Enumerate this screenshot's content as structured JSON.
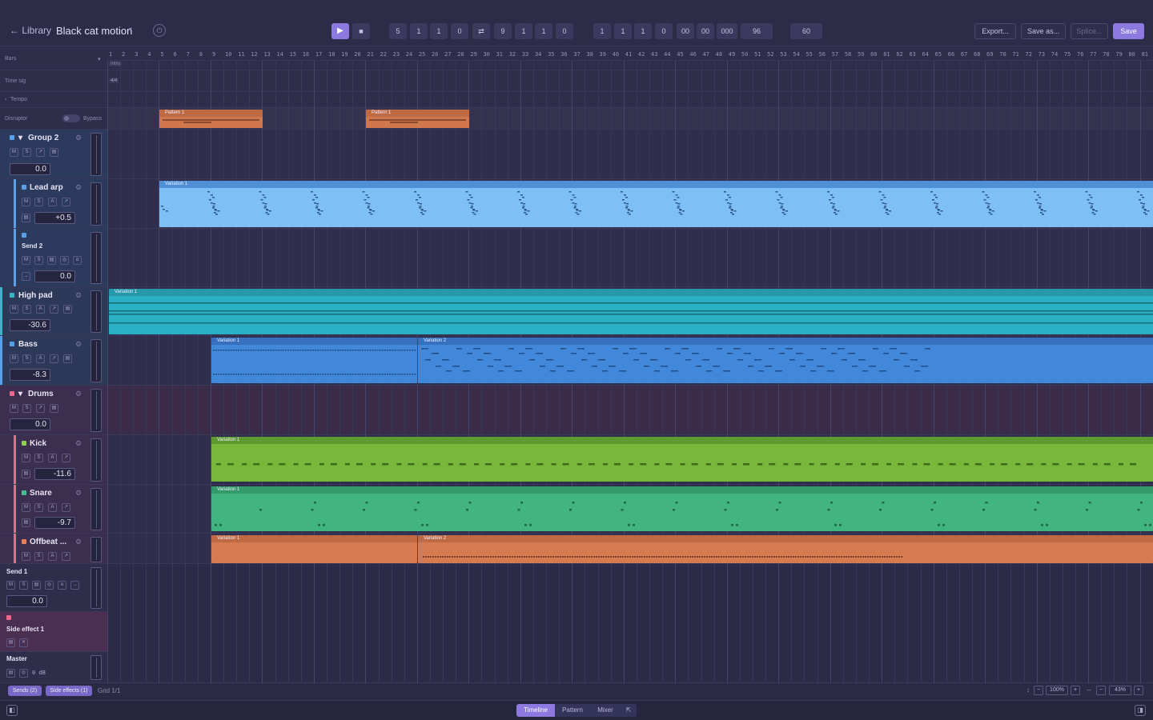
{
  "header": {
    "back_label": "← Library",
    "song_title": "Black cat motion",
    "transport": {
      "play_icon": "▶",
      "stop_icon": "■",
      "loop_start": [
        "5",
        "1",
        "1",
        "0"
      ],
      "loop_icon": "⇄",
      "loop_end": [
        "9",
        "1",
        "1",
        "0"
      ],
      "position": [
        "1",
        "1",
        "1",
        "0",
        "00",
        "00",
        "000"
      ],
      "ppq": "96",
      "bpm": "60"
    },
    "export_label": "Export...",
    "save_as_label": "Save as...",
    "splice_label": "Splice...",
    "save_label": "Save"
  },
  "arrange_header": {
    "bars_label": "Bars",
    "timesig_label": "Time sig",
    "timesig_value": "4/4",
    "tempo_label": "Tempo",
    "marker": "Intro",
    "disruptor_label": "Disruptor",
    "bypass_label": "Bypass",
    "bar_numbers": [
      "1",
      "2",
      "3",
      "4",
      "5",
      "6",
      "7",
      "8",
      "9",
      "10",
      "11",
      "12",
      "13",
      "14",
      "15",
      "16",
      "17",
      "18",
      "19",
      "20",
      "21",
      "22",
      "23",
      "24",
      "25",
      "26",
      "27",
      "28",
      "29",
      "30",
      "31",
      "32",
      "33",
      "34",
      "35",
      "36",
      "37",
      "38",
      "39",
      "40",
      "41",
      "42",
      "43",
      "44",
      "45",
      "46",
      "47",
      "48",
      "49",
      "50",
      "51",
      "52",
      "53",
      "54",
      "55",
      "56",
      "57",
      "58",
      "59",
      "60",
      "61",
      "62",
      "63",
      "64",
      "65",
      "66",
      "67",
      "68",
      "69",
      "70",
      "71",
      "72",
      "73",
      "74",
      "75",
      "76",
      "77",
      "78",
      "79",
      "80",
      "81"
    ]
  },
  "tracks": [
    {
      "name": "Group 2",
      "volume": "0.0",
      "color": "#5aa0e8"
    },
    {
      "name": "Lead arp",
      "volume": "+0.5",
      "color": "#5aa0e8"
    },
    {
      "name": "Send 2",
      "volume": "0.0",
      "color": "#5aa0e8"
    },
    {
      "name": "High pad",
      "volume": "-30.6",
      "color": "#3bb4c8"
    },
    {
      "name": "Bass",
      "volume": "-8.3",
      "color": "#5aa0e8"
    },
    {
      "name": "Drums",
      "volume": "0.0",
      "color": "#e8698a"
    },
    {
      "name": "Kick",
      "volume": "-11.6",
      "color": "#8bd050"
    },
    {
      "name": "Snare",
      "volume": "-9.7",
      "color": "#46c08c"
    },
    {
      "name": "Offbeat ...",
      "volume": "",
      "color": "#e8805a"
    },
    {
      "name": "Send 1",
      "volume": "0.0",
      "color": ""
    },
    {
      "name": "Side effect 1",
      "volume": "",
      "color": "#e8698a"
    },
    {
      "name": "Master",
      "volume": "0 dB",
      "color": ""
    }
  ],
  "button_labels": {
    "mute": "M",
    "solo": "S",
    "arm": "A"
  },
  "clips": {
    "pattern_1": "Pattern 1",
    "variation_1": "Variation 1",
    "variation_2": "Variation 2"
  },
  "bottom": {
    "sends_label": "Sends (2)",
    "side_effects_label": "Side effects (1)",
    "grid_label": "Grid 1/1",
    "zoom_h": "100%",
    "zoom_w": "43%",
    "tabs": [
      "Timeline",
      "Pattern",
      "Mixer"
    ]
  },
  "colors": {
    "accent": "#8d7ae0",
    "lead_arp": "#6fb4ee",
    "high_pad": "#2aacbf",
    "bass": "#3f84d8",
    "kick": "#76b53a",
    "snare": "#3fb57c",
    "offbeat": "#d67a52",
    "pattern": "#d0774e"
  }
}
